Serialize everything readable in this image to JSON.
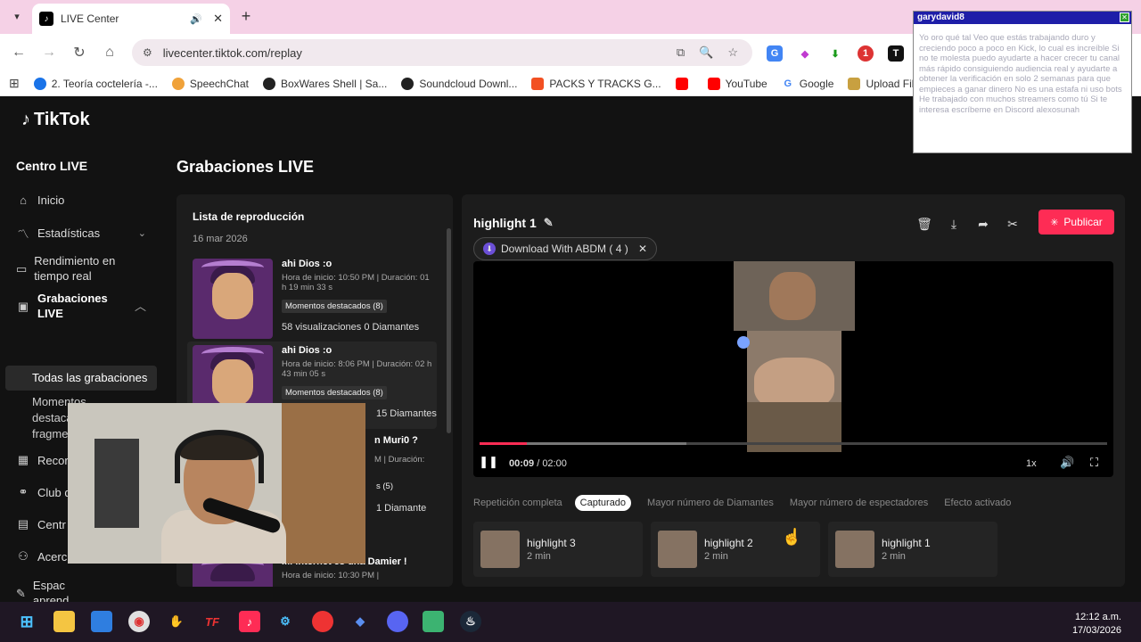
{
  "browser": {
    "tab_title": "LIVE Center",
    "url": "livecenter.tiktok.com/replay",
    "bookmarks": [
      {
        "label": "2. Teoría coctelería -...",
        "color": "#1a73e8"
      },
      {
        "label": "SpeechChat",
        "color": "#f0a23a"
      },
      {
        "label": "BoxWares Shell | Sa...",
        "color": "#222"
      },
      {
        "label": "Soundcloud Downl...",
        "color": "#222"
      },
      {
        "label": "PACKS Y TRACKS G...",
        "color": "#f25022"
      },
      {
        "label": "",
        "color": "#ff0000"
      },
      {
        "label": "YouTube",
        "color": "#ff0000"
      },
      {
        "label": "Google",
        "color": "#4285f4"
      },
      {
        "label": "Upload Files - And",
        "color": "#c8a040"
      }
    ],
    "ext_badge": "1"
  },
  "page": {
    "logo": "TikTok",
    "section": "Centro LIVE",
    "title": "Grabaciones LIVE"
  },
  "sidebar": {
    "items": [
      {
        "label": "Inicio",
        "icon": "home-icon"
      },
      {
        "label": "Estadísticas",
        "icon": "chart-icon"
      },
      {
        "label": "Rendimiento en tiempo real",
        "icon": "monitor-icon"
      },
      {
        "label": "Grabaciones LIVE",
        "icon": "recording-icon"
      },
      {
        "label": "Recor",
        "icon": "calendar-icon"
      },
      {
        "label": "Club d",
        "icon": "club-icon"
      },
      {
        "label": "Centr",
        "icon": "center-icon"
      },
      {
        "label": "Acerc",
        "icon": "about-icon"
      },
      {
        "label": "Espac aprend",
        "icon": "learn-icon"
      }
    ],
    "sub_all": "Todas las grabaciones",
    "sub_moments": "Momentos destacados y fragmentos"
  },
  "playlist": {
    "title": "Lista de reproducción",
    "date": "16 mar 2026",
    "items": [
      {
        "name": "ahi Dios :o",
        "meta": "Hora de inicio: 10:50 PM | Duración: 01 h 19 min 33 s",
        "badge": "Momentos destacados (8)",
        "views": "58 visualizaciones 0 Diamantes"
      },
      {
        "name": "ahi Dios :o",
        "meta": "Hora de inicio: 8:06 PM | Duración: 02 h 43 min 05 s",
        "badge": "Momentos destacados (8)",
        "views": "15 Diamantes"
      },
      {
        "name": "n Muri0 ?",
        "meta": "M | Duración:",
        "badge": "s (5)",
        "views": "1 Diamante"
      },
      {
        "name": "Mi Internet es una Damier !",
        "meta": "Hora de inicio: 10:30 PM |",
        "badge": "",
        "views": ""
      }
    ]
  },
  "viewer": {
    "highlight_title": "highlight 1",
    "publish_label": "Publicar",
    "abdm_label": "Download With ABDM ( 4 )",
    "time_current": "00:09",
    "time_total": "02:00",
    "time_sep": " / ",
    "speed": "1x",
    "progress_played_fraction": 0.075,
    "progress_buffered_fraction": 0.33,
    "filters": [
      {
        "label": "Repetición completa",
        "active": false
      },
      {
        "label": "Capturado",
        "active": true
      },
      {
        "label": "Mayor número de Diamantes",
        "active": false
      },
      {
        "label": "Mayor número de espectadores",
        "active": false
      },
      {
        "label": "Efecto activado",
        "active": false
      }
    ],
    "highlights": [
      {
        "name": "highlight 3",
        "duration": "2 min"
      },
      {
        "name": "highlight 2",
        "duration": "2 min"
      },
      {
        "name": "highlight 1",
        "duration": "2 min"
      }
    ]
  },
  "popup": {
    "title": "garydavid8",
    "message": "Yo oro qué tal Veo que estás trabajando duro y creciendo poco a poco en Kick, lo cual es increíble Si no te molesta puedo ayudarte a hacer crecer tu canal más rápido consiguiendo audiencia real y ayudarte a obtener la verificación en solo 2 semanas para que empieces a ganar dinero No es una estafa ni uso bots He trabajado con muchos streamers como tú Si te interesa escríbeme en Discord alexosunah"
  },
  "taskbar": {
    "time": "12:12 a.m.",
    "date": "17/03/2026"
  }
}
